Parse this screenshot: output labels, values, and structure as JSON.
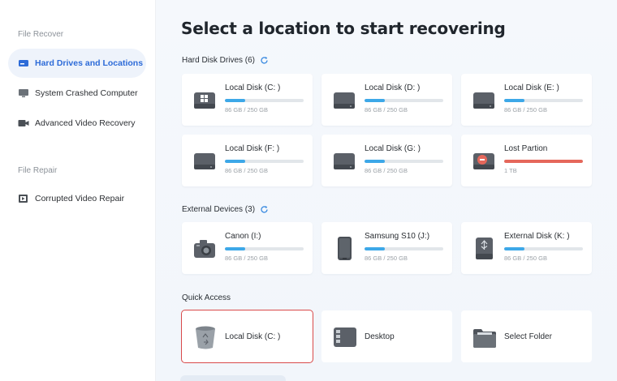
{
  "sidebar": {
    "section_recover": "File Recover",
    "section_repair": "File Repair",
    "items": [
      {
        "label": "Hard Drives and Locations"
      },
      {
        "label": "System Crashed Computer"
      },
      {
        "label": "Advanced Video Recovery"
      },
      {
        "label": "Corrupted Video Repair"
      }
    ]
  },
  "main": {
    "title": "Select a location to start recovering",
    "hard_disk_title": "Hard Disk Drives (6)",
    "external_title": "External Devices (3)",
    "quick_title": "Quick Access",
    "hard_disks": [
      {
        "name": "Local Disk (C: )",
        "size": "86 GB / 250 GB",
        "fill": 0.26,
        "icon": "windows-drive-icon"
      },
      {
        "name": "Local Disk (D: )",
        "size": "86 GB / 250 GB",
        "fill": 0.26,
        "icon": "drive-icon"
      },
      {
        "name": "Local Disk (E: )",
        "size": "86 GB / 250 GB",
        "fill": 0.26,
        "icon": "drive-icon"
      },
      {
        "name": "Local Disk (F: )",
        "size": "86 GB / 250 GB",
        "fill": 0.26,
        "icon": "drive-icon"
      },
      {
        "name": "Local Disk (G: )",
        "size": "86 GB / 250 GB",
        "fill": 0.26,
        "icon": "drive-icon"
      },
      {
        "name": "Lost Partion",
        "size": "1 TB",
        "fill": 1.0,
        "icon": "lost-partition-icon",
        "color": "#e5675b"
      }
    ],
    "external": [
      {
        "name": "Canon (I:)",
        "size": "86 GB / 250 GB",
        "fill": 0.26,
        "icon": "camera-icon"
      },
      {
        "name": "Samsung S10   (J:)",
        "size": "86 GB / 250 GB",
        "fill": 0.26,
        "icon": "phone-icon"
      },
      {
        "name": "External Disk (K: )",
        "size": "86 GB / 250 GB",
        "fill": 0.26,
        "icon": "external-disk-icon"
      }
    ],
    "quick": [
      {
        "name": "Local Disk (C: )",
        "icon": "recycle-bin-icon"
      },
      {
        "name": "Desktop",
        "icon": "desktop-icon"
      },
      {
        "name": "Select Folder",
        "icon": "folder-icon"
      }
    ]
  },
  "colors": {
    "accent": "#2d6bd8",
    "bar_fill": "#3da8e8",
    "lost_bar": "#e5675b",
    "highlight": "#d94a4a"
  }
}
